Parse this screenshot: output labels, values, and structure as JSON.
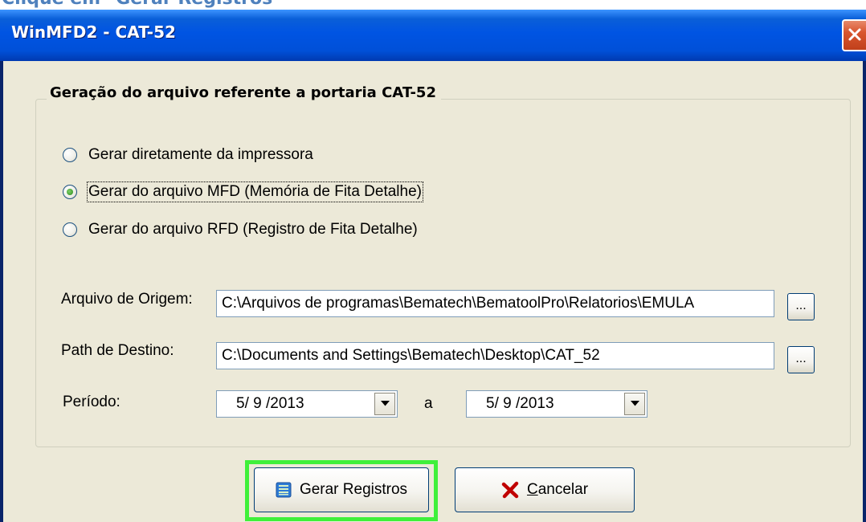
{
  "document": {
    "heading": "Clique em \"Gerar Registros\""
  },
  "window": {
    "title": "WinMFD2 - CAT-52"
  },
  "group": {
    "legend": "Geração do arquivo referente a portaria CAT-52"
  },
  "options": [
    {
      "label": "Gerar diretamente da impressora",
      "checked": false
    },
    {
      "label": "Gerar do arquivo MFD (Memória de Fita Detalhe)",
      "checked": true
    },
    {
      "label": "Gerar do arquivo RFD (Registro de Fita Detalhe)",
      "checked": false
    }
  ],
  "origem": {
    "label": "Arquivo de Origem:",
    "value": "C:\\Arquivos de programas\\Bematech\\BematoolPro\\Relatorios\\EMULA",
    "browse_label": "..."
  },
  "destino": {
    "label": "Path de Destino:",
    "value": "C:\\Documents and Settings\\Bematech\\Desktop\\CAT_52",
    "browse_label": "..."
  },
  "periodo": {
    "label": "Período:",
    "start": "5/ 9 /2013",
    "separator": "a",
    "end": "5/ 9 /2013"
  },
  "buttons": {
    "generate": {
      "label": "Gerar Registros",
      "icon": "list-icon",
      "highlighted": true,
      "highlight_color": "#3ff03a"
    },
    "cancel": {
      "label": "Cancelar",
      "icon": "red-x-icon"
    }
  },
  "colors": {
    "titlebar": "#0054e3",
    "dialog_bg": "#ece9d8",
    "heading": "#4f81bd"
  }
}
